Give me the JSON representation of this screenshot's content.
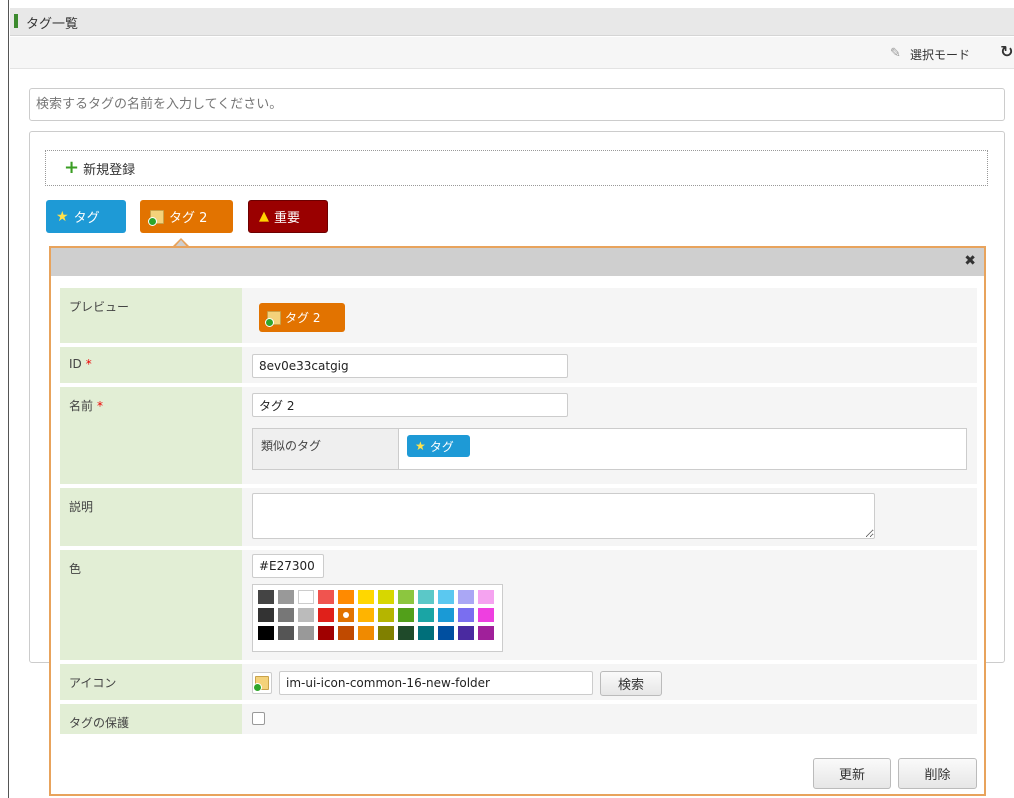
{
  "header": {
    "title": "タグ一覧"
  },
  "toolbar": {
    "mode_label": "選択モード",
    "mode_icon": "pencil-icon",
    "refresh_icon": "refresh-icon"
  },
  "search": {
    "placeholder": "検索するタグの名前を入力してください。"
  },
  "new_registration": {
    "label": "新規登録",
    "icon": "plus-icon"
  },
  "tags": [
    {
      "label": "タグ",
      "icon": "star-icon",
      "color": "#1e9ad6"
    },
    {
      "label": "タグ 2",
      "icon": "folder-new-icon",
      "color": "#e27300"
    },
    {
      "label": "重要",
      "icon": "warning-icon",
      "color": "#9a0000"
    }
  ],
  "editor": {
    "preview_label": "プレビュー",
    "preview_tag": "タグ 2",
    "id_label": "ID",
    "id_value": "8ev0e33catgig",
    "name_label": "名前",
    "name_value": "タグ 2",
    "similar_label": "類似のタグ",
    "similar_tag": "タグ",
    "description_label": "説明",
    "description_value": "",
    "color_label": "色",
    "color_value": "#E27300",
    "palette": [
      [
        "#444444",
        "#999999",
        "#ffffff",
        "#f0544f",
        "#ff8a00",
        "#ffd700",
        "#d7d700",
        "#8cc63f",
        "#5bc8c8",
        "#5bc8f0",
        "#aaa7f5",
        "#f5a3f0"
      ],
      [
        "#333333",
        "#777777",
        "#bbbbbb",
        "#e0201a",
        "#e27300",
        "#ffb400",
        "#b5b500",
        "#52a01a",
        "#1aa5a5",
        "#1a9ad6",
        "#7a6ef0",
        "#ee3fe0"
      ],
      [
        "#000000",
        "#555555",
        "#999999",
        "#a00000",
        "#c04a00",
        "#f08a00",
        "#808000",
        "#1f4a2a",
        "#006f7a",
        "#004fa0",
        "#4a2aa0",
        "#a0209a"
      ]
    ],
    "selected_swatch": "#e27300",
    "icon_label": "アイコン",
    "icon_value": "im-ui-icon-common-16-new-folder",
    "icon_search_button": "検索",
    "protect_label": "タグの保護",
    "protect_checked": false,
    "update_button": "更新",
    "delete_button": "削除"
  }
}
